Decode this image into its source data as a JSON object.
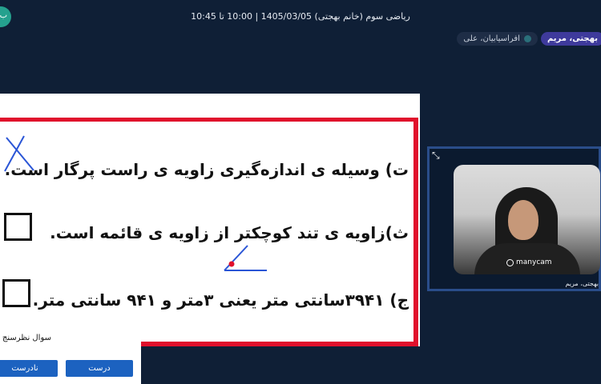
{
  "header": {
    "session_title": "ریاضی سوم (خانم بهجتی) 1405/03/05 | 10:00 تا 10:45",
    "corner_avatar_initial": "ب"
  },
  "participants": [
    {
      "name": "بهجتی، مریم",
      "active": true
    },
    {
      "name": "افراسیابیان، علی",
      "active": false
    }
  ],
  "whiteboard": {
    "line1": "ت) وسیله ی اندازه‌گیری زاویه ی راست پرگار است.",
    "line2": "ث)زاویه ی تند کوچکتر از زاویه ی قائمه است.",
    "line3": "ج) ۳۹۴۱سانتی متر یعنی ۳متر و ۹۴۱ سانتی متر.",
    "frame_color": "#e0102c",
    "annotation_color": "#2a55d6"
  },
  "video": {
    "name": "بهجتی، مریم",
    "watermark": "manycam",
    "expand_icon": "expand-arrows-icon"
  },
  "poll": {
    "title": "سوال نظرسنج",
    "correct_label": "درست",
    "incorrect_label": "نادرست",
    "button_color": "#1c62c0"
  }
}
